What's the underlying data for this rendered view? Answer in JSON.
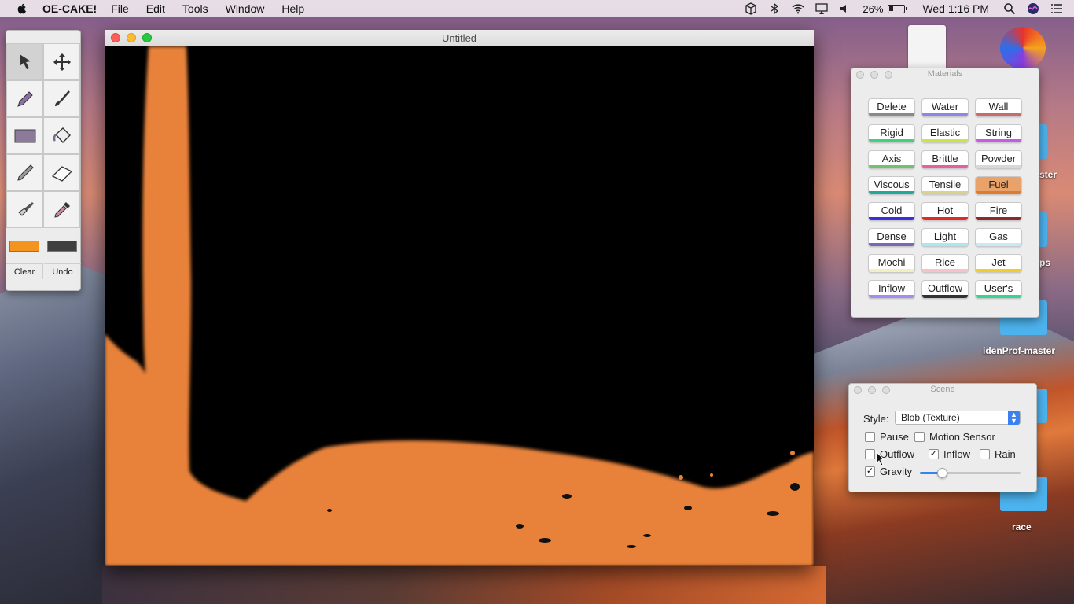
{
  "menubar": {
    "app_name": "OE-CAKE!",
    "menus": [
      "File",
      "Edit",
      "Tools",
      "Window",
      "Help"
    ],
    "battery_percent": "26%",
    "clock": "Wed 1:16 PM"
  },
  "window": {
    "title": "Untitled"
  },
  "palette": {
    "clear_label": "Clear",
    "undo_label": "Undo",
    "primary_color": "#f5931f",
    "secondary_color": "#3f3f3f"
  },
  "materials": {
    "title": "Materials",
    "buttons": [
      {
        "label": "Delete",
        "color": "#8a8a8a"
      },
      {
        "label": "Water",
        "color": "#8f84e8"
      },
      {
        "label": "Wall",
        "color": "#c96b6b"
      },
      {
        "label": "Rigid",
        "color": "#3fd27a"
      },
      {
        "label": "Elastic",
        "color": "#c9e83f"
      },
      {
        "label": "String",
        "color": "#c55be8"
      },
      {
        "label": "Axis",
        "color": "#6fc36f"
      },
      {
        "label": "Brittle",
        "color": "#e85fa0"
      },
      {
        "label": "Powder",
        "color": "#d8d8d8"
      },
      {
        "label": "Viscous",
        "color": "#1fa99a"
      },
      {
        "label": "Tensile",
        "color": "#d9d28a"
      },
      {
        "label": "Fuel",
        "color": "#e07a2c"
      },
      {
        "label": "Cold",
        "color": "#3a2ee0"
      },
      {
        "label": "Hot",
        "color": "#e02a2a"
      },
      {
        "label": "Fire",
        "color": "#8a2a2a"
      },
      {
        "label": "Dense",
        "color": "#7a68b5"
      },
      {
        "label": "Light",
        "color": "#a8e8f0"
      },
      {
        "label": "Gas",
        "color": "#c7eaf5"
      },
      {
        "label": "Mochi",
        "color": "#f4efc3"
      },
      {
        "label": "Rice",
        "color": "#f5c3c8"
      },
      {
        "label": "Jet",
        "color": "#f0cd2a"
      },
      {
        "label": "Inflow",
        "color": "#a58af0"
      },
      {
        "label": "Outflow",
        "color": "#333333"
      },
      {
        "label": "User's",
        "color": "#33d68a"
      }
    ],
    "active": "Fuel"
  },
  "scene": {
    "title": "Scene",
    "style_label": "Style:",
    "style_value": "Blob (Texture)",
    "pause_label": "Pause",
    "pause_checked": false,
    "motion_sensor_label": "Motion Sensor",
    "motion_sensor_checked": false,
    "outflow_label": "Outflow",
    "outflow_checked": false,
    "inflow_label": "Inflow",
    "inflow_checked": true,
    "rain_label": "Rain",
    "rain_checked": false,
    "gravity_label": "Gravity",
    "gravity_checked": true,
    "gravity_slider_fraction": 0.22
  },
  "desktop": {
    "labels": [
      "ster",
      "ps",
      "idenProf-master",
      "race"
    ]
  },
  "fluid_color": "#e8823a"
}
